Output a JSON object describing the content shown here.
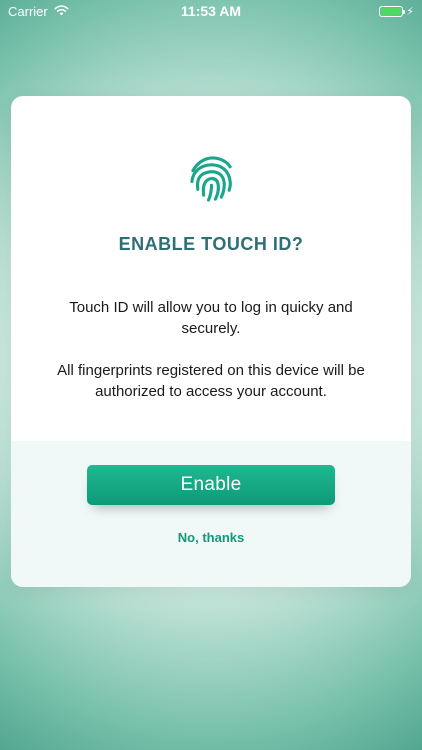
{
  "status_bar": {
    "carrier": "Carrier",
    "time": "11:53 AM",
    "battery_level": 1.0,
    "icons": [
      "wifi-icon",
      "battery-icon",
      "charging-bolt-icon"
    ]
  },
  "dialog": {
    "icon": "fingerprint-icon",
    "title": "ENABLE TOUCH ID?",
    "text_line_1": "Touch ID will allow you to log in quicky and securely.",
    "text_line_2": "All fingerprints registered on this device will be authorized to access your account.",
    "enable_label": "Enable",
    "dismiss_label": "No, thanks"
  },
  "colors": {
    "accent": "#0d9a78",
    "title": "#2d6f74",
    "link": "#12987b",
    "background": "#3f9a84"
  }
}
